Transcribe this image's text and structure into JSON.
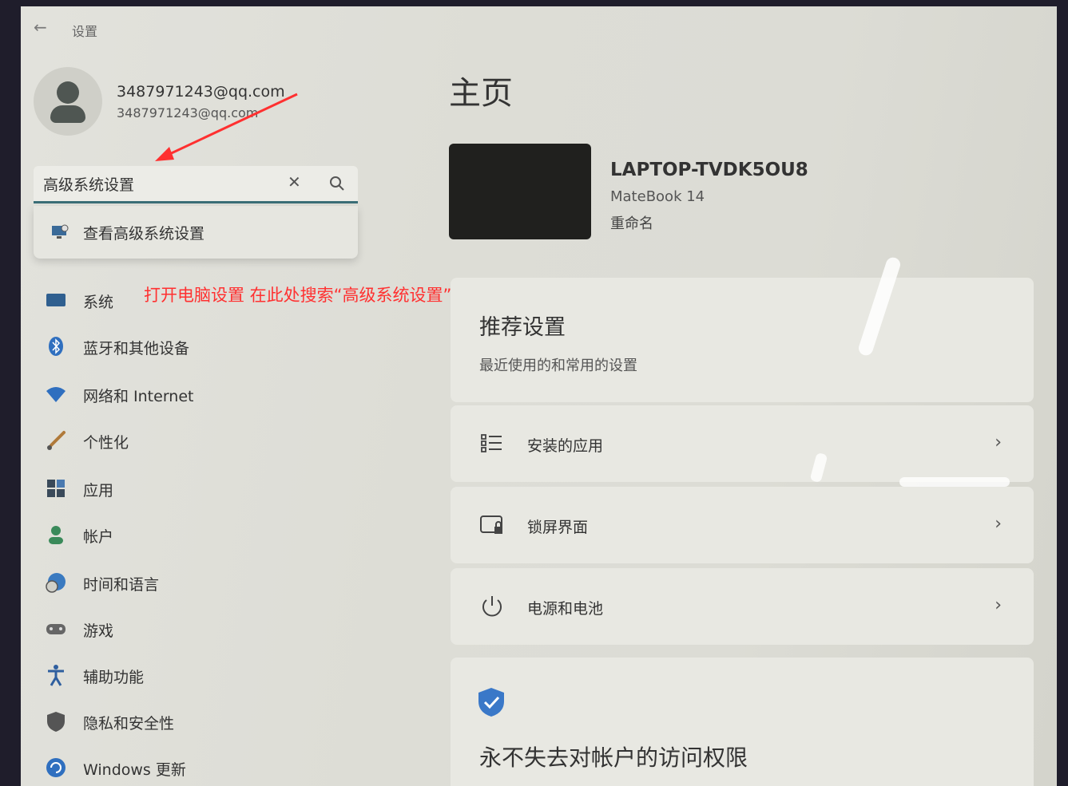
{
  "window": {
    "title": "设置"
  },
  "account": {
    "name": "3487971243@qq.com",
    "email": "3487971243@qq.com"
  },
  "search": {
    "value": "高级系统设置",
    "suggestion": "查看高级系统设置"
  },
  "annotation": {
    "text": "打开电脑设置 在此处搜索“高级系统设置”",
    "color": "#ff3030"
  },
  "sidebar": {
    "items": [
      {
        "label": "系统",
        "icon": "display-icon"
      },
      {
        "label": "蓝牙和其他设备",
        "icon": "bluetooth-icon"
      },
      {
        "label": "网络和 Internet",
        "icon": "wifi-icon"
      },
      {
        "label": "个性化",
        "icon": "brush-icon"
      },
      {
        "label": "应用",
        "icon": "apps-icon"
      },
      {
        "label": "帐户",
        "icon": "person-icon"
      },
      {
        "label": "时间和语言",
        "icon": "globe-clock-icon"
      },
      {
        "label": "游戏",
        "icon": "gamepad-icon"
      },
      {
        "label": "辅助功能",
        "icon": "accessibility-icon"
      },
      {
        "label": "隐私和安全性",
        "icon": "shield-icon"
      },
      {
        "label": "Windows 更新",
        "icon": "update-icon"
      }
    ]
  },
  "main": {
    "title": "主页",
    "device": {
      "name": "LAPTOP-TVDK5OU8",
      "model": "MateBook 14",
      "rename": "重命名"
    },
    "recommended": {
      "title": "推荐设置",
      "subtitle": "最近使用的和常用的设置",
      "rows": [
        {
          "label": "安装的应用",
          "icon": "list-icon"
        },
        {
          "label": "锁屏界面",
          "icon": "lock-screen-icon"
        },
        {
          "label": "电源和电池",
          "icon": "power-icon"
        }
      ]
    },
    "account_card": {
      "title": "永不失去对帐户的访问权限"
    }
  },
  "colors": {
    "accent": "#3b6e77",
    "shield": "#3a78c8"
  }
}
